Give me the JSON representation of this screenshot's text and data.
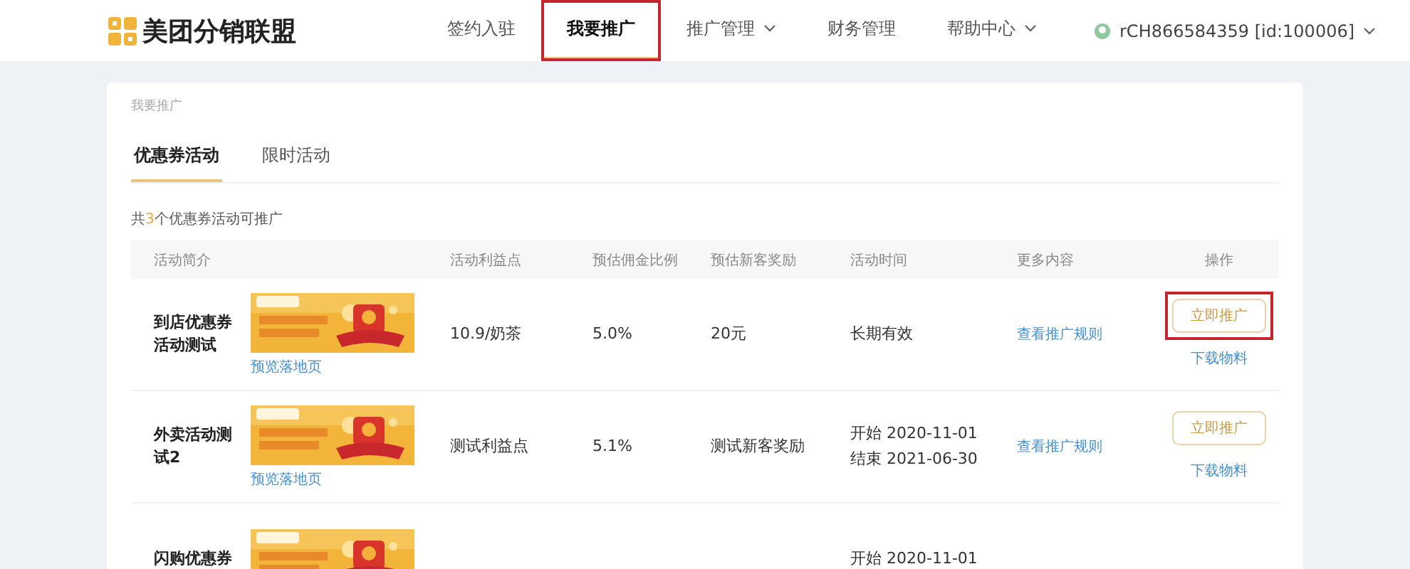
{
  "header": {
    "logo": "美团分销联盟",
    "nav": [
      {
        "label": "签约入驻",
        "selected": false,
        "dropdown": false,
        "highlighted": false
      },
      {
        "label": "我要推广",
        "selected": true,
        "dropdown": false,
        "highlighted": true
      },
      {
        "label": "推广管理",
        "selected": false,
        "dropdown": true,
        "highlighted": false
      },
      {
        "label": "财务管理",
        "selected": false,
        "dropdown": false,
        "highlighted": false
      },
      {
        "label": "帮助中心",
        "selected": false,
        "dropdown": true,
        "highlighted": false
      }
    ],
    "user": "rCH866584359 [id:100006]"
  },
  "breadcrumb": "我要推广",
  "tabs": [
    {
      "label": "优惠券活动",
      "selected": true
    },
    {
      "label": "限时活动",
      "selected": false
    }
  ],
  "summary": "共**3**个优惠券活动可推广",
  "table": {
    "columns": [
      "活动简介",
      "活动利益点",
      "预估佣金比例",
      "预估新客奖励",
      "活动时间",
      "更多内容",
      "操作"
    ],
    "rows": [
      {
        "name": "到店优惠券活动测试",
        "preview": "预览落地页",
        "benefit": "10.9/奶茶",
        "commission": "5.0%",
        "reward": "20元",
        "time": [
          "长期有效"
        ],
        "more": "查看推广规则",
        "action": "立即推广",
        "highlighted": true,
        "download": "下载物料"
      },
      {
        "name": "外卖活动测试2",
        "preview": "预览落地页",
        "benefit": "测试利益点",
        "commission": "5.1%",
        "reward": "测试新客奖励",
        "time": [
          "开始 2020-11-01",
          "结束 2021-06-30"
        ],
        "more": "查看推广规则",
        "action": "立即推广",
        "highlighted": false,
        "download": "下载物料"
      },
      {
        "name": "闪购优惠券",
        "time": [
          "开始 2020-11-01"
        ]
      }
    ]
  }
}
